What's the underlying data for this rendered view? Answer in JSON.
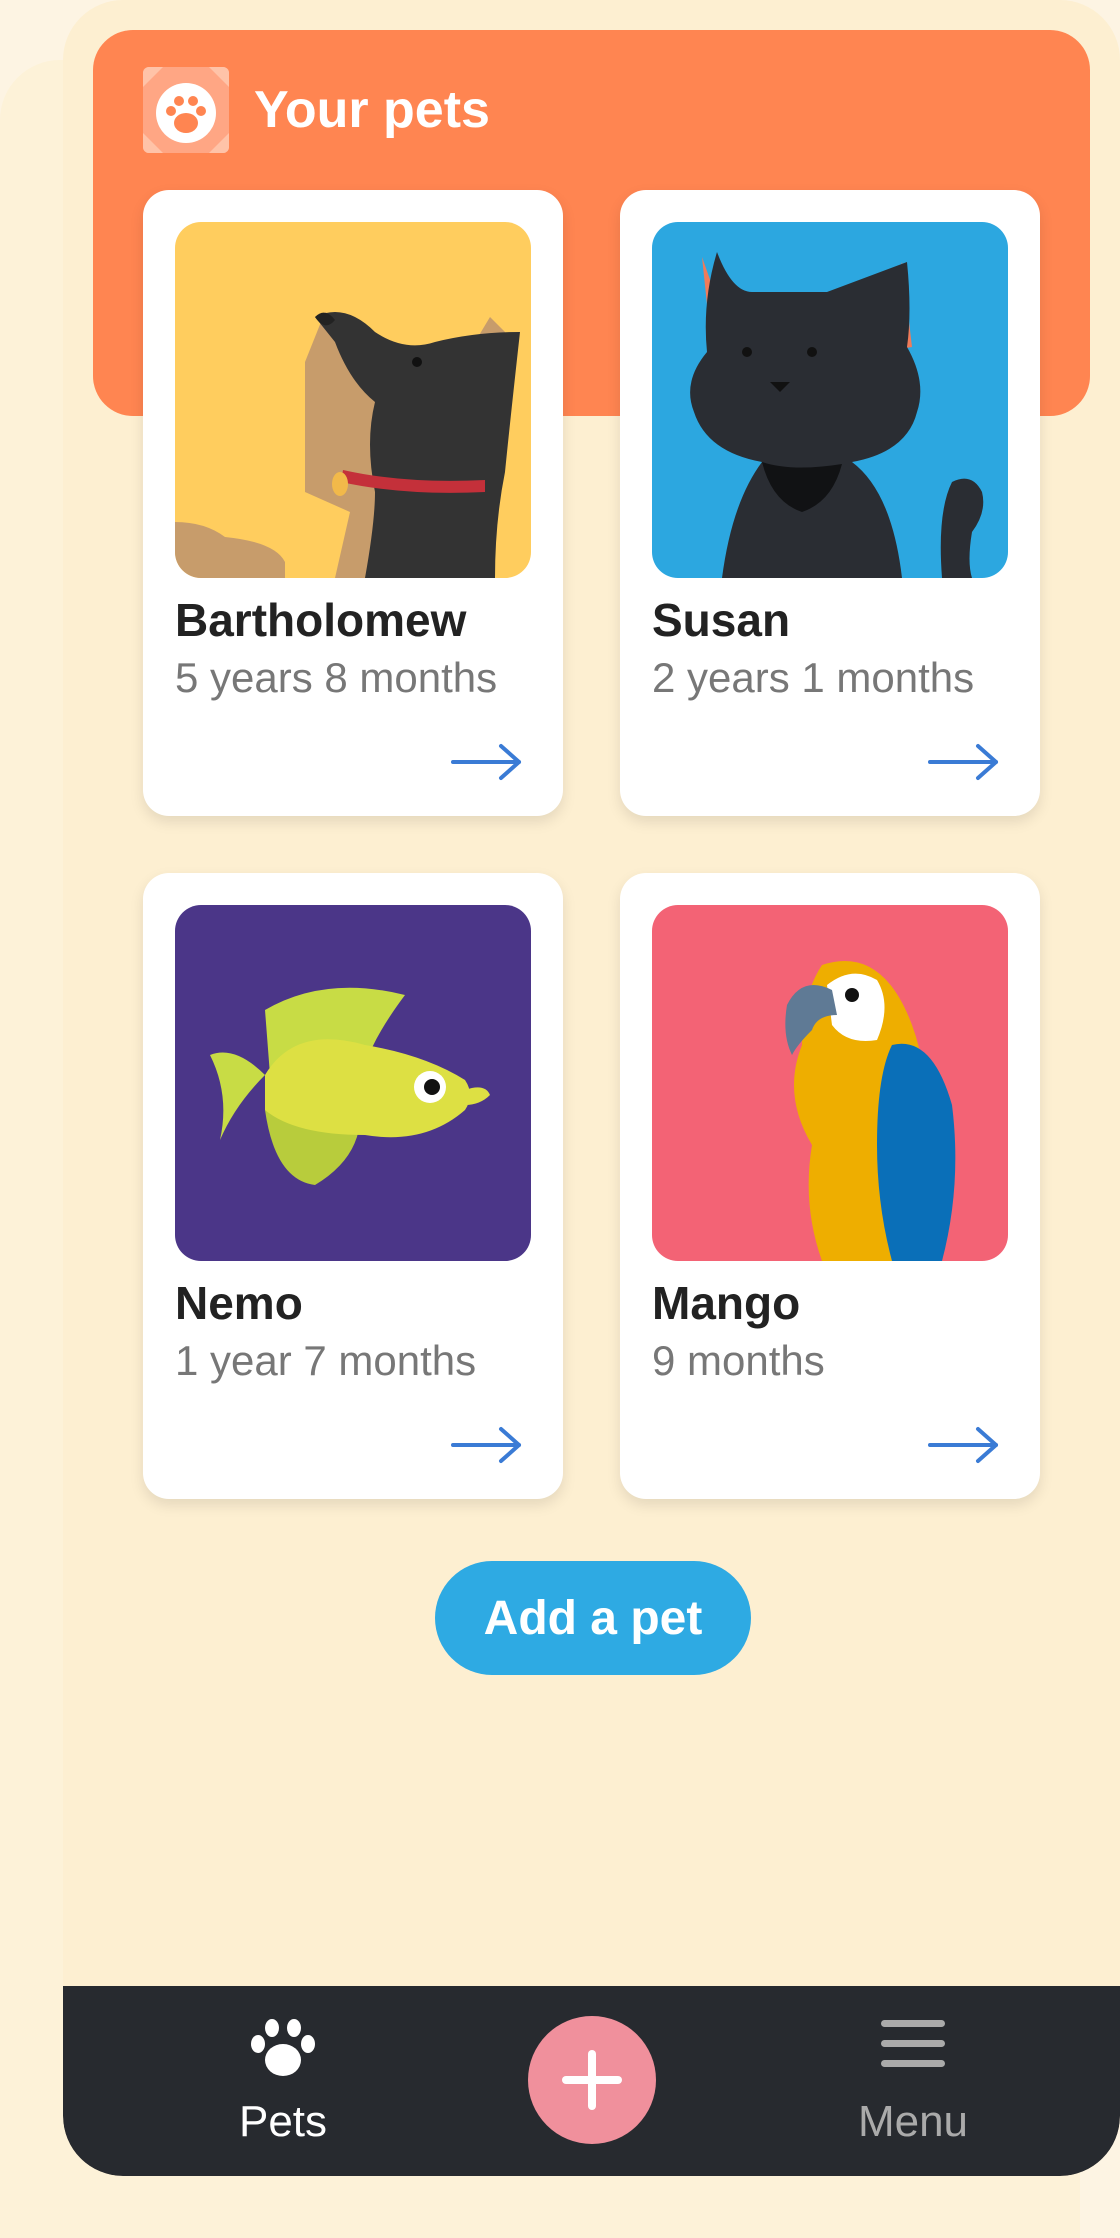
{
  "header": {
    "title": "Your pets"
  },
  "pets": [
    {
      "name": "Bartholomew",
      "age": "5 years 8 months",
      "species": "dog",
      "bg": "#ffcd5e"
    },
    {
      "name": "Susan",
      "age": "2 years 1 months",
      "species": "cat",
      "bg": "#2ca7e0"
    },
    {
      "name": "Nemo",
      "age": "1 year 7 months",
      "species": "fish",
      "bg": "#4b3688"
    },
    {
      "name": "Mango",
      "age": "9 months",
      "species": "parrot",
      "bg": "#f36375"
    }
  ],
  "actions": {
    "add_pet_label": "Add a pet"
  },
  "nav": {
    "pets_label": "Pets",
    "menu_label": "Menu",
    "pets_icon": "paw-icon",
    "add_icon": "plus-icon",
    "menu_icon": "hamburger-icon"
  },
  "colors": {
    "header": "#ff8551",
    "accent_blue": "#2eaae3",
    "fab_pink": "#f0909c",
    "nav_bg": "#272a2f"
  }
}
